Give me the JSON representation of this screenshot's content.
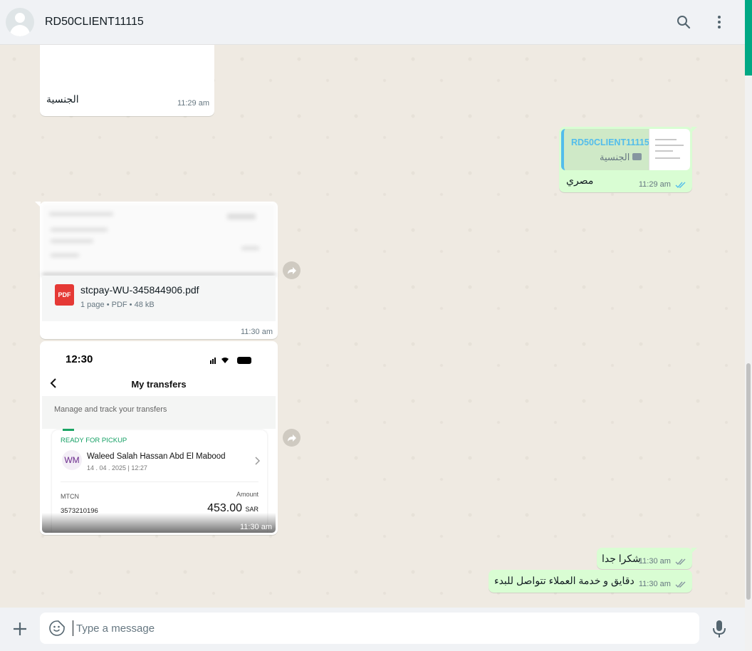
{
  "header": {
    "title": "RD50CLIENT11115"
  },
  "messages": {
    "m1": {
      "text": "الجنسية",
      "time": "11:29 am"
    },
    "m2": {
      "quote_name": "RD50CLIENT11115",
      "quote_text": "الجنسية",
      "text": "مصري",
      "time": "11:29 am"
    },
    "m3": {
      "file_name": "stcpay-WU-345844906.pdf",
      "file_meta": "1 page • PDF • 48 kB",
      "file_type": "PDF",
      "time": "11:30 am"
    },
    "m4": {
      "status_time": "12:30",
      "screen_title": "My transfers",
      "subtitle": "Manage and track your transfers",
      "status": "READY FOR PICKUP",
      "initials": "WM",
      "name": "Waleed Salah Hassan Abd  El Mabood",
      "date": "14 . 04 . 2025 | 12:27",
      "mtcn_label": "MTCN",
      "mtcn_value": "3573210196",
      "amount_label": "Amount",
      "amount_value": "453.00",
      "currency": "SAR",
      "time": "11:30 am"
    },
    "m5": {
      "text": "شكرا جدا",
      "time": "11:30 am"
    },
    "m6": {
      "text": "دقايق و خدمة العملاء تتواصل للبدء",
      "time": "11:30 am"
    }
  },
  "composer": {
    "placeholder": "Type a message",
    "value": ""
  },
  "colors": {
    "outgoing_bubble": "#d9fdd3",
    "incoming_bubble": "#ffffff",
    "chat_background": "#efeae2",
    "read_ticks": "#53bdeb",
    "accent": "#00a884"
  }
}
